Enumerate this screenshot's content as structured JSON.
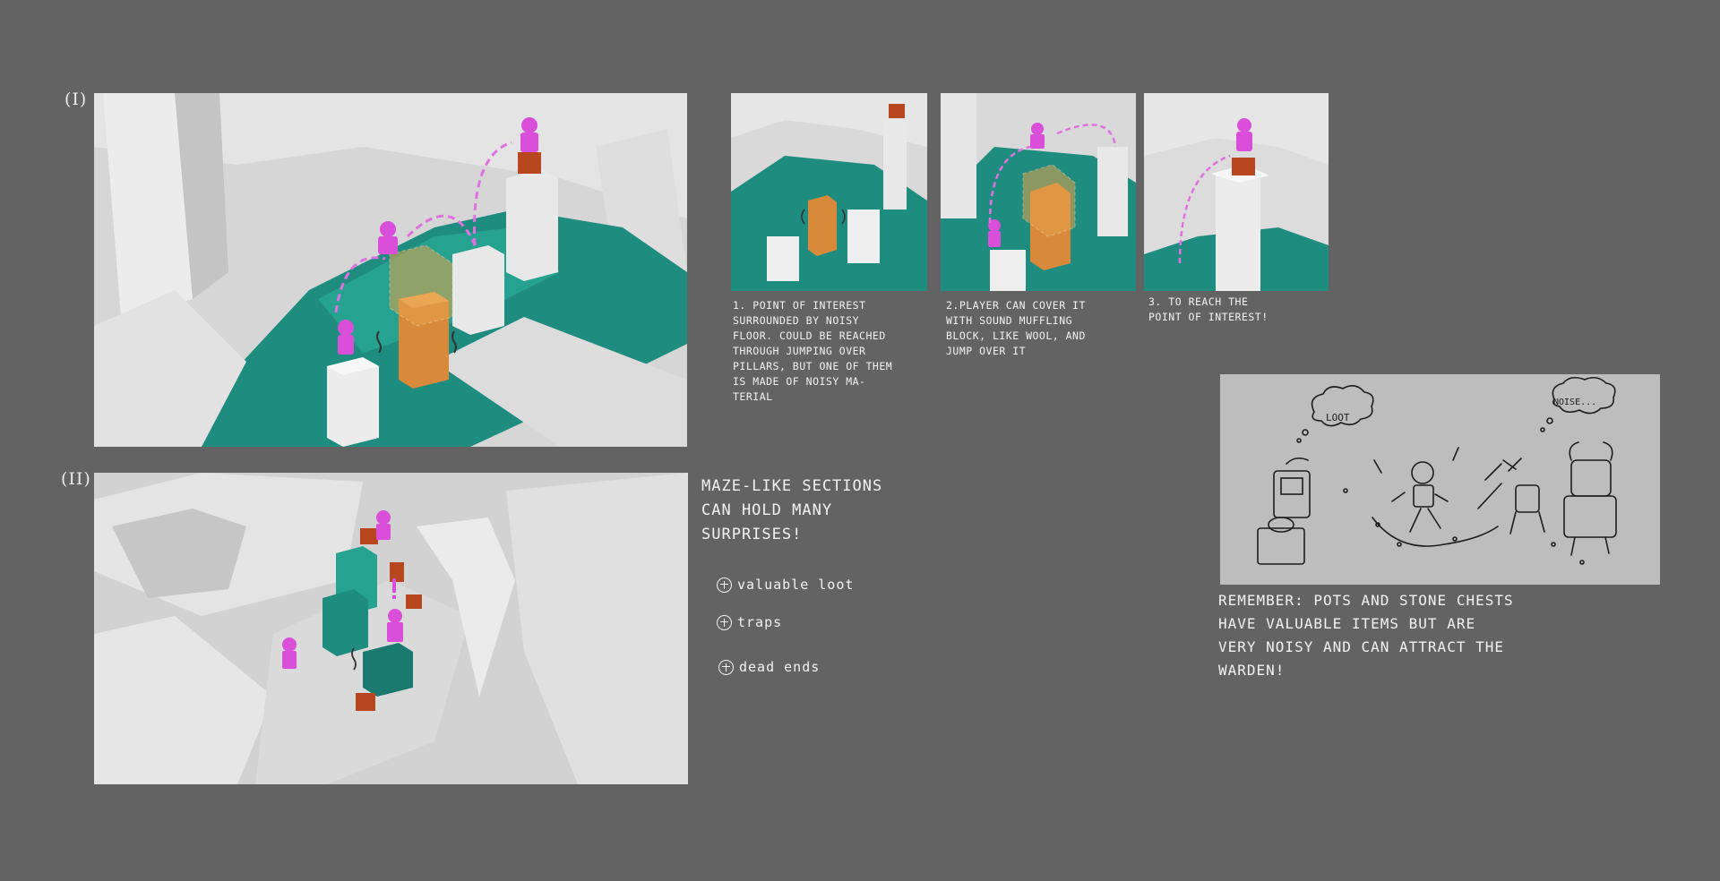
{
  "section_labels": {
    "one": "(I)",
    "two": "(II)"
  },
  "steps": [
    {
      "number": "1.",
      "text": "Point of interest\nsurrounded by noisy\nfloor. could be reached\nthrough jumping over\npillars, but one of them\nis made of noisy ma-\nterial"
    },
    {
      "number": "2.",
      "text": "player can cover it\nwith sound muffling\nblock, like wool, and\njump over it"
    },
    {
      "number": "3.",
      "text": "to reach the\npoint of interest!"
    }
  ],
  "maze_note": "maze-like sections\ncan hold many\nsurprises!",
  "bullets": [
    "valuable loot",
    "traps",
    "dead ends"
  ],
  "sketch": {
    "bubble_left": "LOOT",
    "bubble_right": "NOISE..."
  },
  "remember_note": "remember: pots and stone chests\nhave valuable items but are\nvery noisy and can attract the\nwarden!",
  "colors": {
    "background": "#636363",
    "floor_teal": "#1f8c80",
    "block_white": "#e6e6e6",
    "player_magenta": "#d94fd9",
    "noisy_block_orange": "#d9893a",
    "chest_red": "#b8461f",
    "sketch_paper": "#bdbdbd"
  }
}
